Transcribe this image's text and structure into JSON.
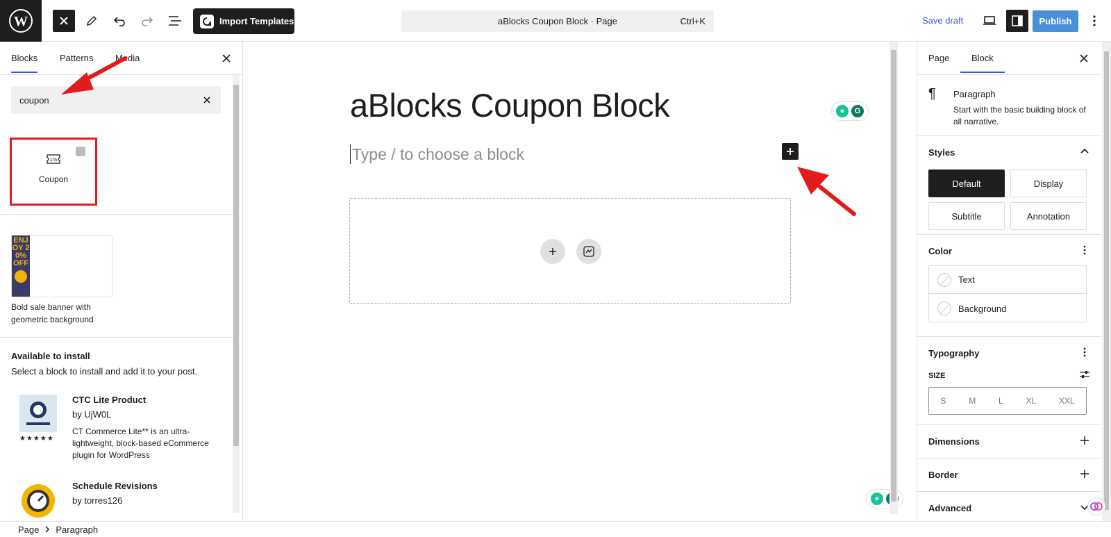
{
  "toolbar": {
    "import_label": "Import Templates",
    "command_title": "aBlocks Coupon Block · Page",
    "command_shortcut": "Ctrl+K",
    "save_draft": "Save draft",
    "publish": "Publish"
  },
  "inserter": {
    "tabs": [
      "Blocks",
      "Patterns",
      "Media"
    ],
    "search_value": "coupon",
    "block_result": "Coupon",
    "pattern_thumb_text": "ENJOY 20% OFF",
    "pattern_label": "Bold sale banner with geometric background",
    "available_title": "Available to install",
    "available_desc": "Select a block to install and add it to your post.",
    "plugins": [
      {
        "name": "CTC Lite Product",
        "author": "by UjW0L",
        "stars": "★★★★★",
        "description": "CT Commerce Lite** is an ultra-lightweight, block-based eCommerce plugin for WordPress"
      },
      {
        "name": "Schedule Revisions",
        "author": "by torres126"
      }
    ]
  },
  "canvas": {
    "title": "aBlocks Coupon Block",
    "placeholder": "Type / to choose a block"
  },
  "settings": {
    "tabs": [
      "Page",
      "Block"
    ],
    "block_name": "Paragraph",
    "block_desc": "Start with the basic building block of all narrative.",
    "styles_title": "Styles",
    "styles": [
      "Default",
      "Display",
      "Subtitle",
      "Annotation"
    ],
    "color_title": "Color",
    "color_items": [
      "Text",
      "Background"
    ],
    "typography_title": "Typography",
    "size_label": "SIZE",
    "sizes": [
      "S",
      "M",
      "L",
      "XL",
      "XXL"
    ],
    "dimensions_title": "Dimensions",
    "border_title": "Border",
    "advanced_title": "Advanced"
  },
  "breadcrumb": {
    "items": [
      "Page",
      "Paragraph"
    ]
  },
  "colors": {
    "accent": "#3858e9",
    "publish": "#4a90d9",
    "annotation": "#e21c1c",
    "dark": "#1e1e1e"
  }
}
